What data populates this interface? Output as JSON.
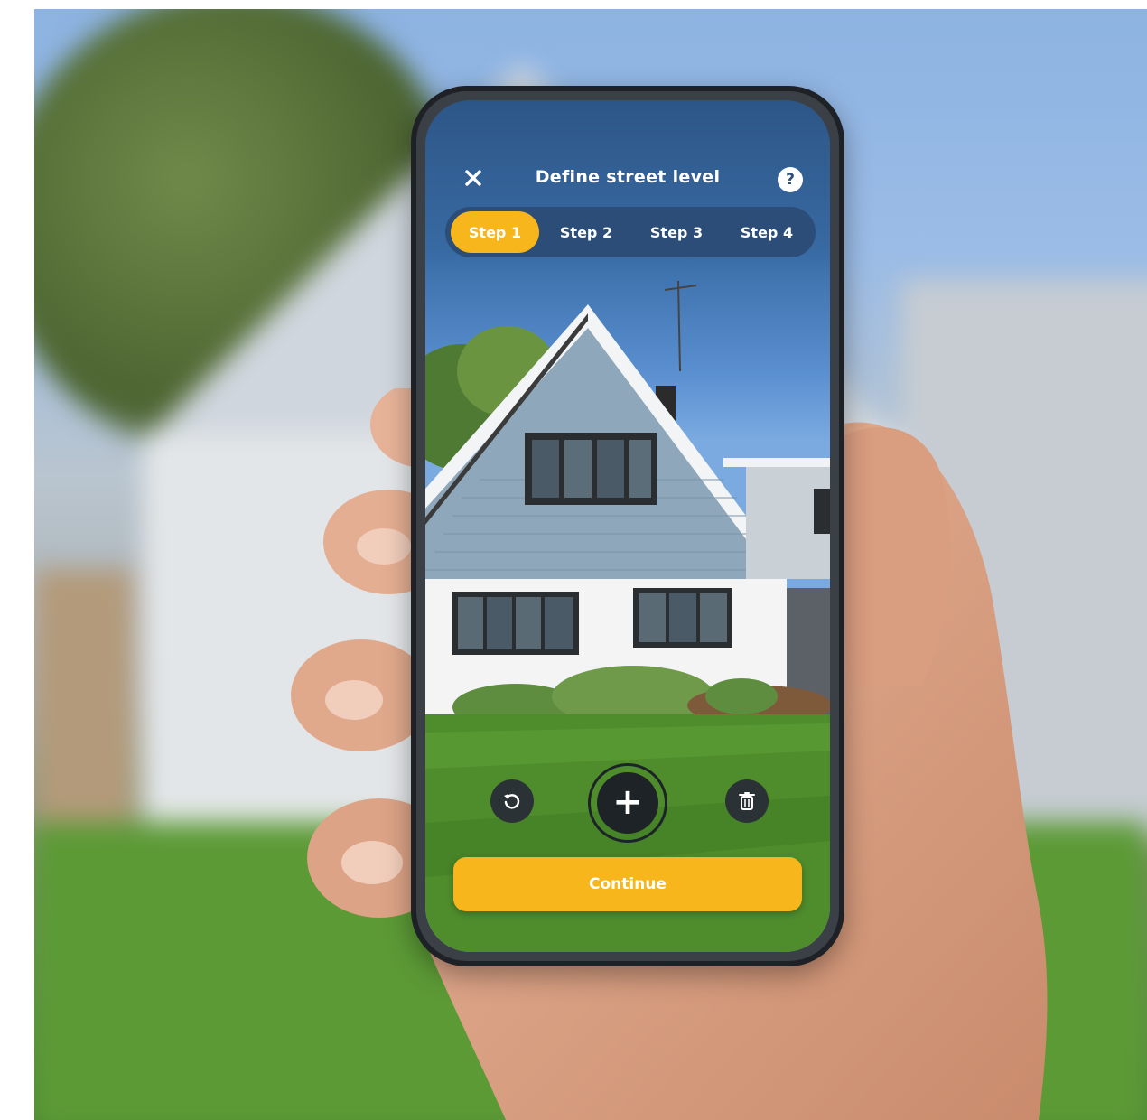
{
  "app": {
    "title": "Define street level"
  },
  "header": {
    "close_icon": "close-icon",
    "help_icon": "help-icon",
    "help_glyph": "?"
  },
  "steps": [
    {
      "label": "Step 1",
      "active": true
    },
    {
      "label": "Step 2",
      "active": false
    },
    {
      "label": "Step 3",
      "active": false
    },
    {
      "label": "Step 4",
      "active": false
    }
  ],
  "controls": {
    "undo_icon": "undo-icon",
    "add_icon": "add-icon",
    "delete_icon": "trash-icon",
    "add_glyph": "+"
  },
  "continue_button": {
    "label": "Continue"
  },
  "colors": {
    "accent": "#f7b61b",
    "steps_bar": "#2b4d78",
    "header_bg": "#2f5b8e"
  }
}
